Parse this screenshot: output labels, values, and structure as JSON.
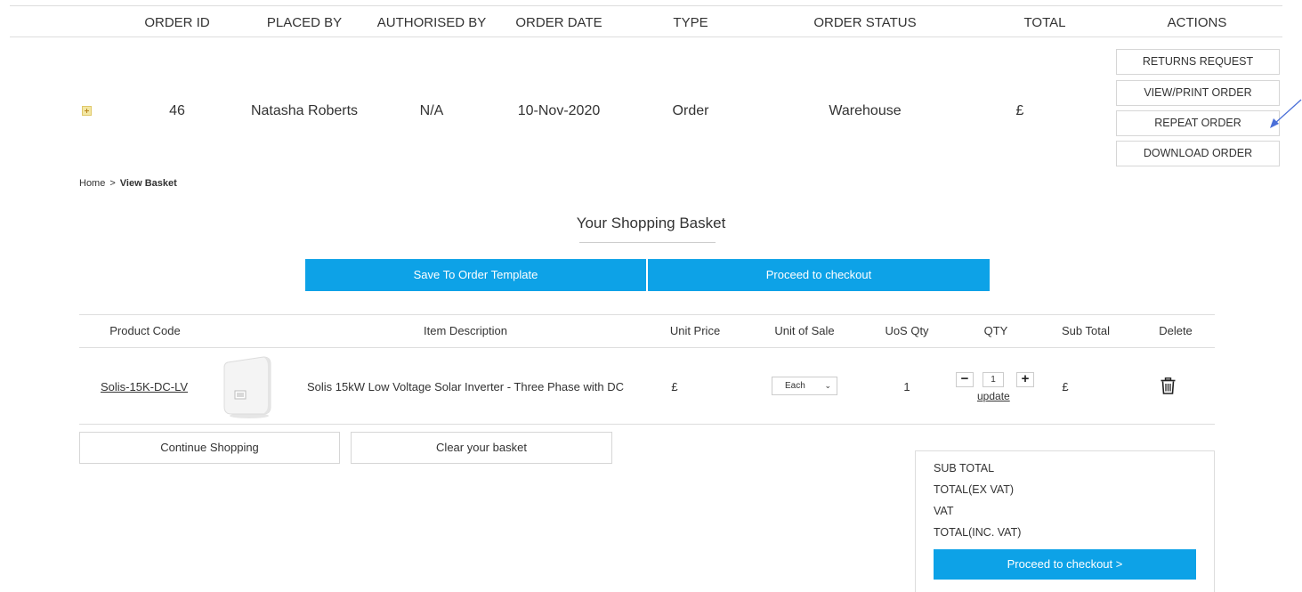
{
  "orders_table": {
    "headers": [
      "ORDER ID",
      "PLACED BY",
      "AUTHORISED BY",
      "ORDER DATE",
      "TYPE",
      "ORDER STATUS",
      "TOTAL",
      "ACTIONS"
    ],
    "row": {
      "order_id": "46",
      "placed_by": "Natasha Roberts",
      "authorised_by": "N/A",
      "order_date": "10-Nov-2020",
      "type": "Order",
      "order_status": "Warehouse",
      "total": "£"
    },
    "actions": [
      "RETURNS REQUEST",
      "VIEW/PRINT ORDER",
      "REPEAT ORDER",
      "DOWNLOAD ORDER"
    ]
  },
  "annotation": {
    "arrow_color": "#4a6fd8",
    "points_to": "REPEAT ORDER"
  },
  "breadcrumb": {
    "home": "Home",
    "separator": ">",
    "current": "View Basket"
  },
  "basket": {
    "title": "Your Shopping Basket",
    "save_template_label": "Save To Order Template",
    "proceed_label": "Proceed to checkout",
    "headers": [
      "Product Code",
      "Item Description",
      "Unit Price",
      "Unit of Sale",
      "UoS Qty",
      "QTY",
      "Sub Total",
      "Delete"
    ],
    "item": {
      "product_code": "Solis-15K-DC-LV",
      "description": "Solis 15kW Low Voltage Solar Inverter - Three Phase with DC",
      "unit_price": "£",
      "unit_of_sale": "Each",
      "uos_qty": "1",
      "qty": "1",
      "update_label": "update",
      "sub_total": "£"
    },
    "continue_label": "Continue Shopping",
    "clear_label": "Clear your basket"
  },
  "totals": {
    "sub_total_label": "SUB TOTAL",
    "total_ex_vat_label": "TOTAL(EX VAT)",
    "vat_label": "VAT",
    "total_inc_vat_label": "TOTAL(INC. VAT)",
    "checkout_label": "Proceed to checkout >"
  },
  "colors": {
    "accent": "#0da2e7",
    "border": "#dddddd",
    "text": "#333333"
  }
}
